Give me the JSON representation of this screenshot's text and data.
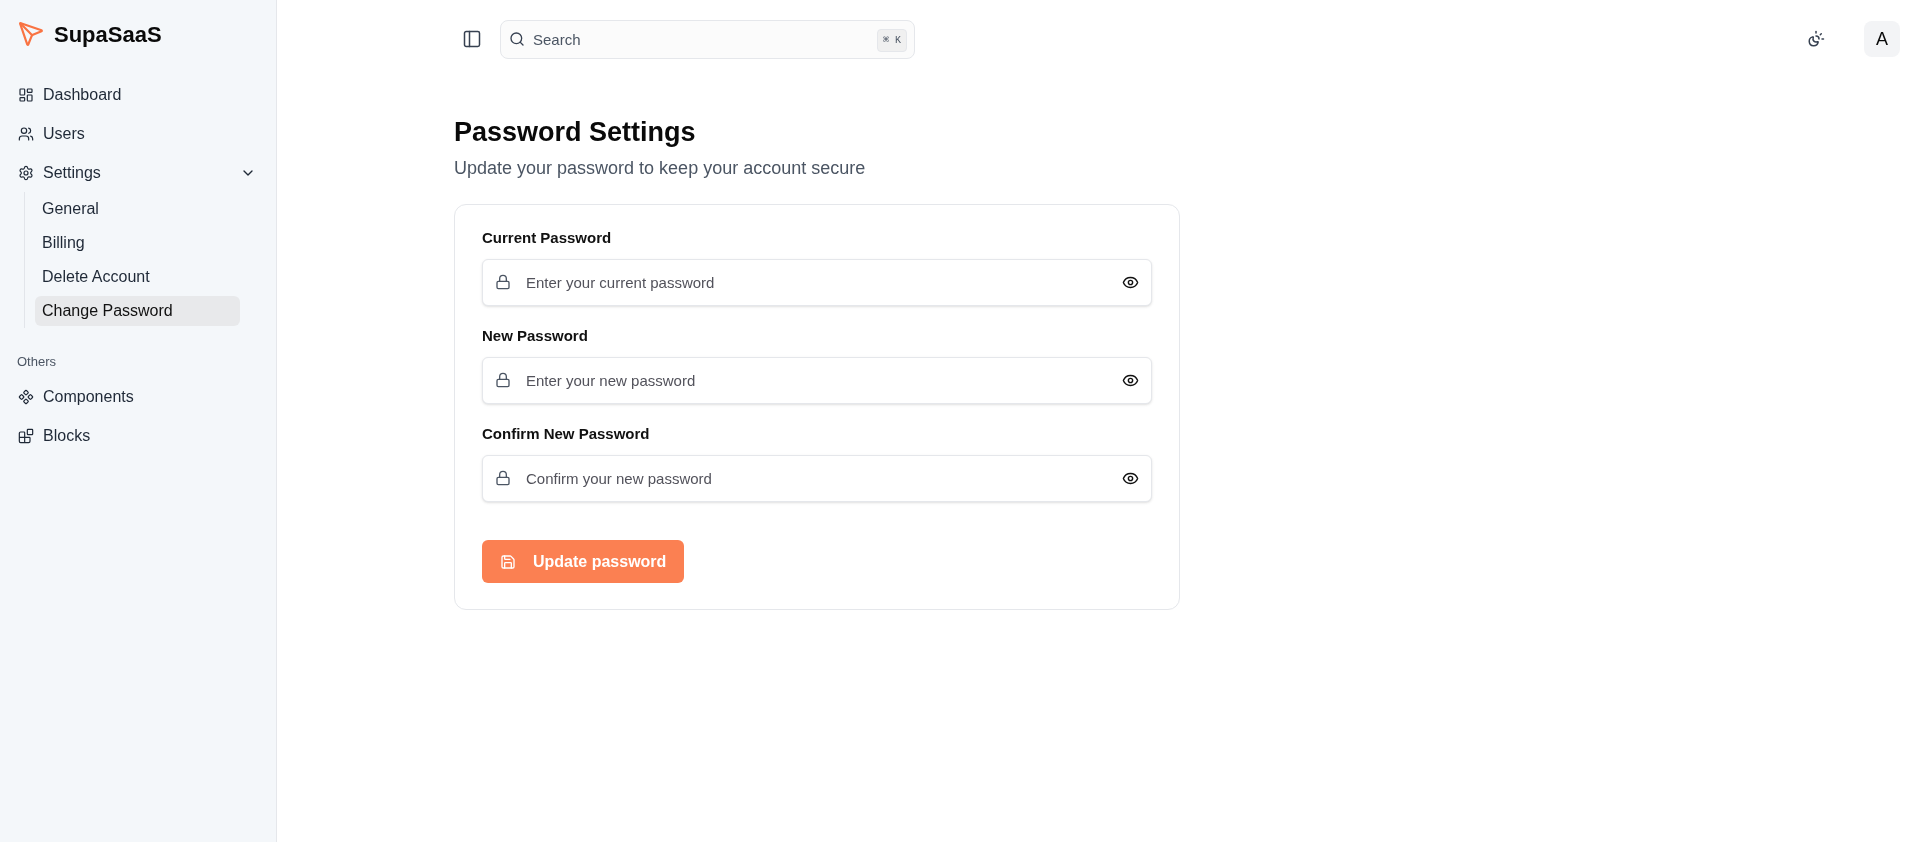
{
  "brand": {
    "name": "SupaSaaS"
  },
  "sidebar": {
    "items": [
      {
        "kind": "link",
        "label": "Dashboard"
      },
      {
        "kind": "link",
        "label": "Users"
      },
      {
        "kind": "group",
        "label": "Settings",
        "expanded": true,
        "children": [
          {
            "label": "General",
            "selected": false
          },
          {
            "label": "Billing",
            "selected": false
          },
          {
            "label": "Delete Account",
            "selected": false
          },
          {
            "label": "Change Password",
            "selected": true
          }
        ]
      }
    ],
    "sections": [
      {
        "title": "Others",
        "items": [
          {
            "label": "Components"
          },
          {
            "label": "Blocks"
          }
        ]
      }
    ]
  },
  "topbar": {
    "search": {
      "placeholder": "Search",
      "shortcut": "⌘ K"
    },
    "avatar": "A"
  },
  "page": {
    "title": "Password Settings",
    "subtitle": "Update your password to keep your account secure"
  },
  "form": {
    "fields": [
      {
        "label": "Current Password",
        "placeholder": "Enter your current password"
      },
      {
        "label": "New Password",
        "placeholder": "Enter your new password"
      },
      {
        "label": "Confirm New Password",
        "placeholder": "Confirm your new password"
      }
    ],
    "submit": "Update password"
  }
}
